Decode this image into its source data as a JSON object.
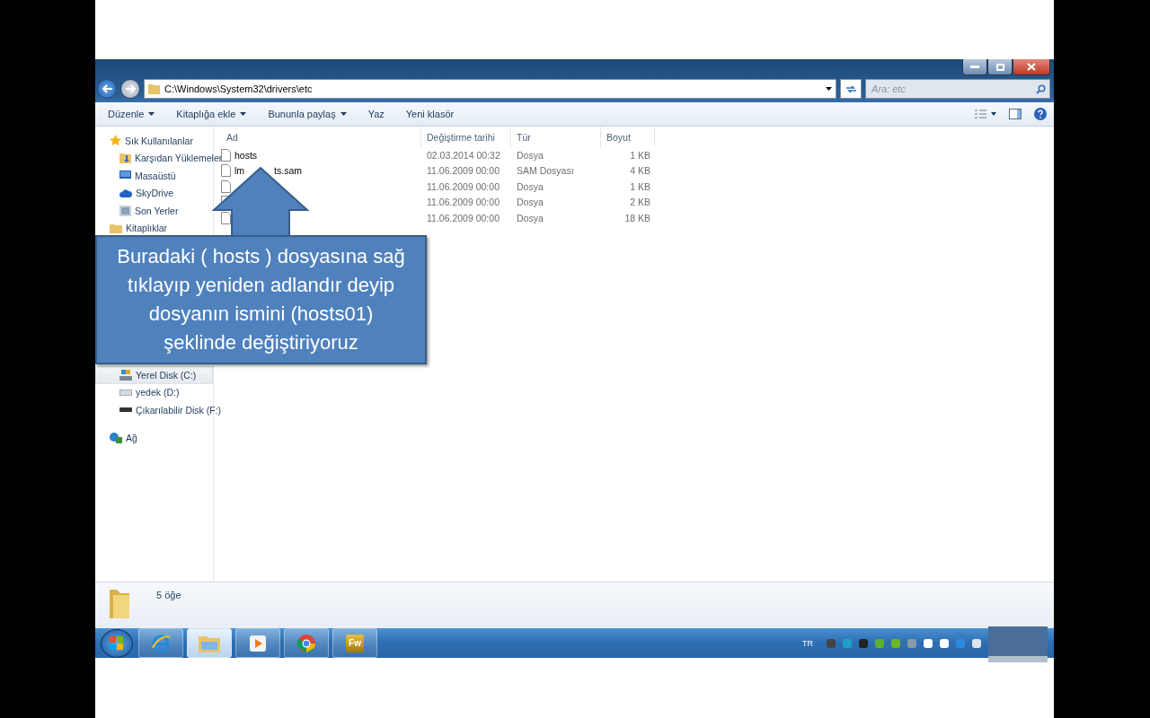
{
  "window": {
    "address": "C:\\Windows\\System32\\drivers\\etc",
    "search": {
      "placeholder": "Ara: etc"
    }
  },
  "toolbar": [
    {
      "label": "Düzenle",
      "dropdown": true
    },
    {
      "label": "Kitaplığa ekle",
      "dropdown": true
    },
    {
      "label": "Bununla paylaş",
      "dropdown": true
    },
    {
      "label": "Yaz",
      "dropdown": false
    },
    {
      "label": "Yeni klasör",
      "dropdown": false
    }
  ],
  "sidebar": {
    "groups": [
      {
        "label": "Sık Kullanılanlar",
        "children": [
          {
            "label": "Karşıdan Yüklemeler",
            "selected": false
          },
          {
            "label": "Masaüstü",
            "selected": false
          },
          {
            "label": "SkyDrive",
            "selected": false
          },
          {
            "label": "Son Yerler",
            "selected": false
          }
        ]
      },
      {
        "label": "Kitaplıklar"
      },
      {
        "children": [
          {
            "label": "Yerel Disk (C:)",
            "selected": true
          },
          {
            "label": "yedek (D:)",
            "selected": false
          },
          {
            "label": "Çıkarılabilir Disk (F:)",
            "selected": false
          }
        ]
      },
      {
        "label": "Ağ"
      }
    ]
  },
  "table": {
    "columns": [
      "Ad",
      "Değiştirme tarihi",
      "Tür",
      "Boyut"
    ],
    "rows": [
      {
        "name": "hosts",
        "modified": "02.03.2014 00:32",
        "type": "Dosya",
        "size": "1 KB"
      },
      {
        "name_parts": [
          "lm",
          "ts.sam"
        ],
        "modified": "11.06.2009 00:00",
        "type": "SAM Dosyası",
        "size": "4 KB"
      },
      {
        "modified": "11.06.2009 00:00",
        "type": "Dosya",
        "size": "1 KB"
      },
      {
        "modified": "11.06.2009 00:00",
        "type": "Dosya",
        "size": "2 KB"
      },
      {
        "modified": "11.06.2009 00:00",
        "type": "Dosya",
        "size": "18 KB"
      }
    ]
  },
  "status_bar": {
    "count": "5 öğe"
  },
  "callout": {
    "lines": [
      "Buradaki ( hosts ) dosyasına sağ",
      "tıklayıp yeniden adlandır deyip",
      "dosyanın ismini (hosts01)",
      "şeklinde değiştiriyoruz"
    ]
  },
  "taskbar": {
    "apps": [
      {
        "selected": false
      },
      {
        "selected": true
      },
      {
        "selected": false
      },
      {
        "selected": false
      },
      {
        "selected": false,
        "label": "Fw"
      }
    ],
    "language": "TR"
  }
}
